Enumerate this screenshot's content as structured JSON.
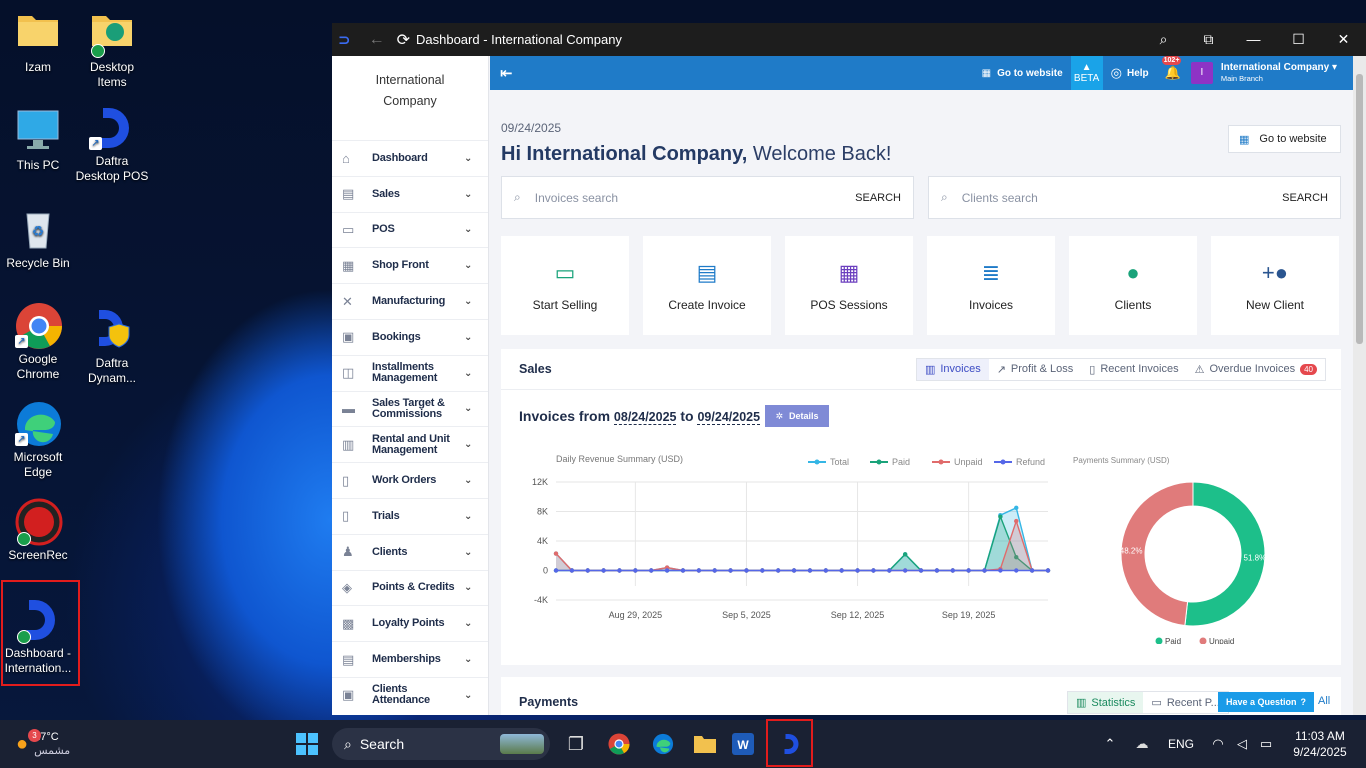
{
  "desktop": {
    "icons": [
      {
        "label": "Izam",
        "icon": "folder-icon"
      },
      {
        "label": "Desktop Items",
        "icon": "edge-folder-icon"
      },
      {
        "label": "This PC",
        "icon": "monitor-icon"
      },
      {
        "label": "Daftra Desktop POS",
        "icon": "daftra-icon"
      },
      {
        "label": "Recycle Bin",
        "icon": "recycle-bin-icon"
      },
      {
        "label": "Google Chrome",
        "icon": "chrome-icon"
      },
      {
        "label": "Daftra Dynam...",
        "icon": "daftra-shield-icon"
      },
      {
        "label": "Microsoft Edge",
        "icon": "edge-icon"
      },
      {
        "label": "ScreenRec",
        "icon": "screenrec-icon"
      },
      {
        "label": "Dashboard - Internation...",
        "icon": "daftra-icon"
      }
    ]
  },
  "window": {
    "title": "Dashboard - International Company"
  },
  "sidebar": {
    "org": "International Company",
    "items": [
      {
        "label": "Dashboard",
        "icon": "home-icon"
      },
      {
        "label": "Sales",
        "icon": "sales-icon"
      },
      {
        "label": "POS",
        "icon": "pos-icon"
      },
      {
        "label": "Shop Front",
        "icon": "store-icon"
      },
      {
        "label": "Manufacturing",
        "icon": "tools-icon"
      },
      {
        "label": "Bookings",
        "icon": "calendar-icon"
      },
      {
        "label": "Installments Management",
        "icon": "installments-icon"
      },
      {
        "label": "Sales Target & Commissions",
        "icon": "money-icon"
      },
      {
        "label": "Rental and Unit Management",
        "icon": "rental-icon"
      },
      {
        "label": "Work Orders",
        "icon": "clipboard-icon"
      },
      {
        "label": "Trials",
        "icon": "clipboard-icon"
      },
      {
        "label": "Clients",
        "icon": "user-icon"
      },
      {
        "label": "Points & Credits",
        "icon": "layers-icon"
      },
      {
        "label": "Loyalty Points",
        "icon": "gift-icon"
      },
      {
        "label": "Memberships",
        "icon": "id-card-icon"
      },
      {
        "label": "Clients Attendance",
        "icon": "calendar-icon"
      }
    ]
  },
  "header": {
    "go_to_website": "Go to website",
    "beta": "BETA",
    "help": "Help",
    "notif_badge": "102+",
    "avatar": "I",
    "company": "International Company",
    "branch": "Main Branch"
  },
  "main": {
    "date": "09/24/2025",
    "welcome_name": "Hi International Company,",
    "welcome_rest": " Welcome Back!",
    "go_to_website": "Go to website",
    "invoices_search": {
      "placeholder": "Invoices search",
      "button": "SEARCH"
    },
    "clients_search": {
      "placeholder": "Clients search",
      "button": "SEARCH"
    },
    "tiles": [
      {
        "label": "Start Selling",
        "color": "#1aa37a"
      },
      {
        "label": "Create Invoice",
        "color": "#1f7bc8"
      },
      {
        "label": "POS Sessions",
        "color": "#6b3fbf"
      },
      {
        "label": "Invoices",
        "color": "#1f7bc8"
      },
      {
        "label": "Clients",
        "color": "#1aa37a"
      },
      {
        "label": "New Client",
        "color": "#2a5590"
      }
    ],
    "sales": {
      "title": "Sales",
      "tabs": [
        "Invoices",
        "Profit & Loss",
        "Recent Invoices",
        "Overdue Invoices"
      ],
      "overdue_badge": "40",
      "range_prefix": "Invoices from",
      "from": "08/24/2025",
      "to_word": "to",
      "to": "09/24/2025",
      "details": "Details"
    },
    "payments": {
      "title": "Payments",
      "tab_statistics": "Statistics",
      "tab_recent": "Recent P...",
      "view_all": "All"
    }
  },
  "help_button": "Have a Question",
  "chart_data": [
    {
      "type": "line",
      "title": "Daily Revenue Summary (USD)",
      "ylim": [
        -4000,
        12000
      ],
      "yticks": [
        "12K",
        "8K",
        "4K",
        "0",
        "-4K"
      ],
      "xticks": [
        "Aug 29, 2025",
        "Sep 5, 2025",
        "Sep 12, 2025",
        "Sep 19, 2025"
      ],
      "x": [
        "Aug 24",
        "Aug 25",
        "Aug 26",
        "Aug 27",
        "Aug 28",
        "Aug 29",
        "Aug 30",
        "Aug 31",
        "Sep 1",
        "Sep 2",
        "Sep 3",
        "Sep 4",
        "Sep 5",
        "Sep 6",
        "Sep 7",
        "Sep 8",
        "Sep 9",
        "Sep 10",
        "Sep 11",
        "Sep 12",
        "Sep 13",
        "Sep 14",
        "Sep 15",
        "Sep 16",
        "Sep 17",
        "Sep 18",
        "Sep 19",
        "Sep 20",
        "Sep 21",
        "Sep 22",
        "Sep 23",
        "Sep 24"
      ],
      "series": [
        {
          "name": "Total",
          "color": "#35b6e5",
          "values": [
            2300,
            0,
            0,
            0,
            0,
            0,
            0,
            400,
            0,
            0,
            0,
            0,
            0,
            0,
            0,
            0,
            0,
            0,
            0,
            0,
            0,
            0,
            2200,
            0,
            0,
            0,
            0,
            0,
            7500,
            8500,
            0,
            0
          ]
        },
        {
          "name": "Paid",
          "color": "#1aa37a",
          "values": [
            0,
            0,
            0,
            0,
            0,
            0,
            0,
            0,
            0,
            0,
            0,
            0,
            0,
            0,
            0,
            0,
            0,
            0,
            0,
            0,
            0,
            0,
            2200,
            0,
            0,
            0,
            0,
            0,
            7300,
            1800,
            0,
            0
          ]
        },
        {
          "name": "Unpaid",
          "color": "#e06b6b",
          "values": [
            2300,
            0,
            0,
            0,
            0,
            0,
            0,
            400,
            0,
            0,
            0,
            0,
            0,
            0,
            0,
            0,
            0,
            0,
            0,
            0,
            0,
            0,
            0,
            0,
            0,
            0,
            0,
            0,
            200,
            6700,
            0,
            0
          ]
        },
        {
          "name": "Refund",
          "color": "#5567e8",
          "values": [
            0,
            0,
            0,
            0,
            0,
            0,
            0,
            0,
            0,
            0,
            0,
            0,
            0,
            0,
            0,
            0,
            0,
            0,
            0,
            0,
            0,
            0,
            0,
            0,
            0,
            0,
            0,
            0,
            0,
            0,
            0,
            0
          ]
        }
      ]
    },
    {
      "type": "pie",
      "title": "Payments Summary (USD)",
      "slices": [
        {
          "name": "Paid",
          "value": 51.8,
          "label": "51.8%",
          "color": "#1dbf8a"
        },
        {
          "name": "Unpaid",
          "value": 48.2,
          "label": "48.2%",
          "color": "#e07b7b"
        }
      ]
    }
  ],
  "taskbar": {
    "weather_temp": "27°C",
    "weather_desc": "مشمس",
    "weather_badge": "3",
    "search": "Search",
    "lang": "ENG",
    "time": "11:03 AM",
    "date": "9/24/2025"
  }
}
